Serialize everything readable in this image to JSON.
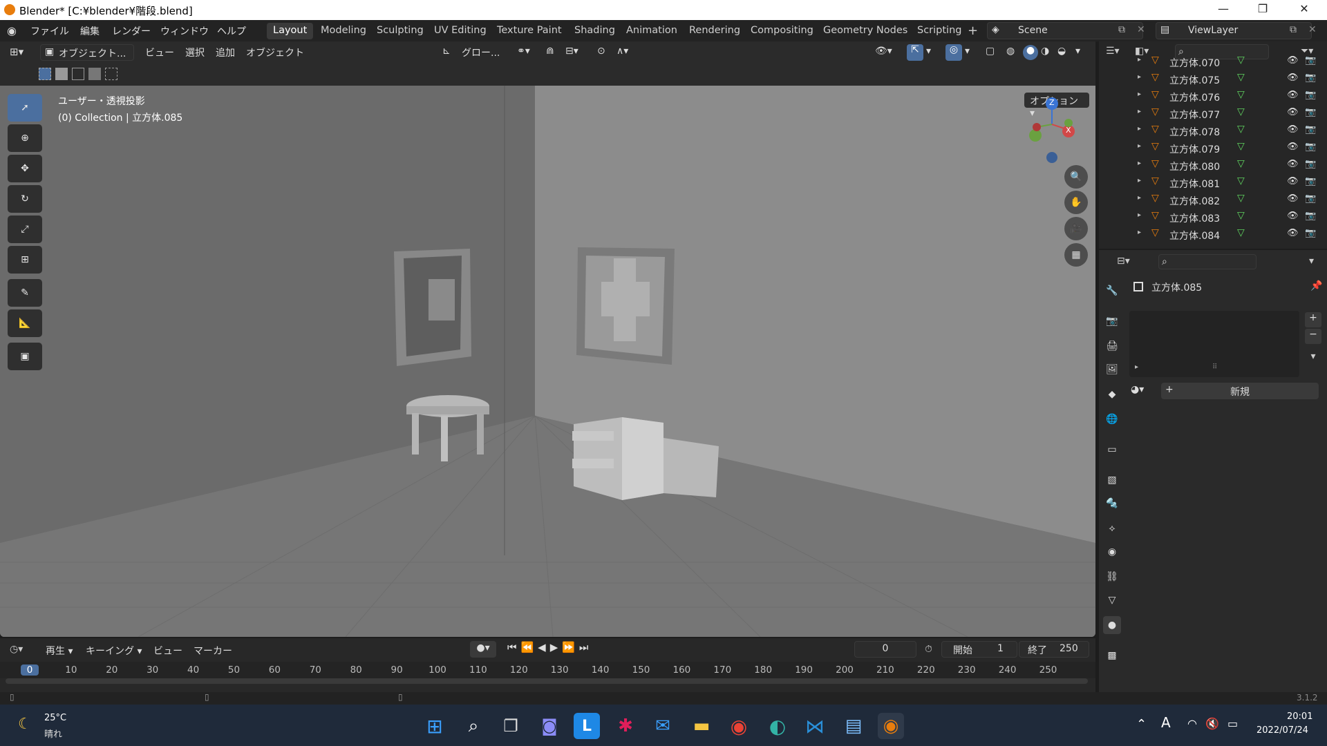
{
  "window": {
    "title": "Blender* [C:¥blender¥階段.blend]"
  },
  "menu": [
    "ファイル",
    "編集",
    "レンダー",
    "ウィンドウ",
    "ヘルプ"
  ],
  "workspaces": [
    "Layout",
    "Modeling",
    "Sculpting",
    "UV Editing",
    "Texture Paint",
    "Shading",
    "Animation",
    "Rendering",
    "Compositing",
    "Geometry Nodes",
    "Scripting"
  ],
  "active_workspace": "Layout",
  "scene": {
    "name": "Scene"
  },
  "viewlayer": {
    "name": "ViewLayer"
  },
  "viewport_header": {
    "mode": "オブジェクト...",
    "menus": [
      "ビュー",
      "選択",
      "追加",
      "オブジェクト"
    ],
    "transform_orientation": "グロー..."
  },
  "viewport": {
    "options": "オプション",
    "overlay_line1": "ユーザー・透視投影",
    "overlay_line2": "(0) Collection | 立方体.085",
    "gizmo": {
      "z": "Z",
      "x": "X"
    }
  },
  "outliner": {
    "items": [
      "立方体.070",
      "立方体.075",
      "立方体.076",
      "立方体.077",
      "立方体.078",
      "立方体.079",
      "立方体.080",
      "立方体.081",
      "立方体.082",
      "立方体.083",
      "立方体.084"
    ]
  },
  "properties": {
    "object_name": "立方体.085",
    "new_button": "新規"
  },
  "timeline": {
    "menus": [
      "再生",
      "キーイング",
      "ビュー",
      "マーカー"
    ],
    "current_frame": "0",
    "start_label": "開始",
    "start_value": "1",
    "end_label": "終了",
    "end_value": "250",
    "ruler": [
      "0",
      "10",
      "20",
      "30",
      "40",
      "50",
      "60",
      "70",
      "80",
      "90",
      "100",
      "110",
      "120",
      "130",
      "140",
      "150",
      "160",
      "170",
      "180",
      "190",
      "200",
      "210",
      "220",
      "230",
      "240",
      "250"
    ]
  },
  "statusbar": {
    "version": "3.1.2"
  },
  "taskbar": {
    "weather_temp": "25°C",
    "weather_text": "晴れ",
    "ime": "A",
    "time": "20:01",
    "date": "2022/07/24"
  },
  "colors": {
    "accent": "#4b6f9f",
    "blender_orange": "#e87d0d",
    "mesh_green": "#5fd35f"
  }
}
